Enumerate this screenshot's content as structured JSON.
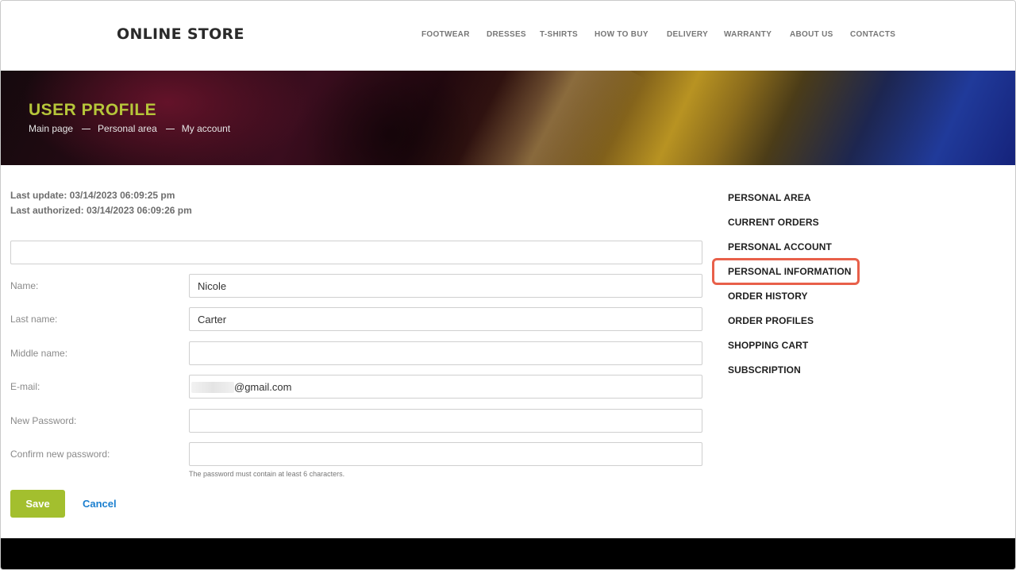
{
  "header": {
    "logo": "ONLINE STORE",
    "nav": [
      "FOOTWEAR",
      "DRESSES",
      "T-SHIRTS",
      "HOW TO BUY",
      "DELIVERY",
      "WARRANTY",
      "ABOUT US",
      "CONTACTS"
    ]
  },
  "banner": {
    "title": "USER PROFILE",
    "breadcrumb": [
      "Main page",
      "Personal area",
      "My account"
    ]
  },
  "meta": {
    "last_update": "Last update: 03/14/2023 06:09:25 pm",
    "last_authorized": "Last authorized: 03/14/2023 06:09:26 pm"
  },
  "form": {
    "name_label": "Name:",
    "name_value": "Nicole",
    "last_name_label": "Last name:",
    "last_name_value": "Carter",
    "middle_name_label": "Middle name:",
    "middle_name_value": "",
    "email_label": "E-mail:",
    "email_value": "@gmail.com",
    "new_password_label": "New Password:",
    "confirm_password_label": "Confirm new password:",
    "password_hint": "The password must contain at least 6 characters.",
    "save_label": "Save",
    "cancel_label": "Cancel"
  },
  "sidebar": {
    "items": [
      "PERSONAL AREA",
      "CURRENT ORDERS",
      "PERSONAL ACCOUNT",
      "PERSONAL INFORMATION",
      "ORDER HISTORY",
      "ORDER PROFILES",
      "SHOPPING CART",
      "SUBSCRIPTION"
    ],
    "highlighted": "PERSONAL INFORMATION",
    "highlight_color": "#e8604a"
  },
  "colors": {
    "accent_green": "#a3bf2e",
    "title_green": "#b6c63a",
    "link_blue": "#1b7fcf"
  }
}
